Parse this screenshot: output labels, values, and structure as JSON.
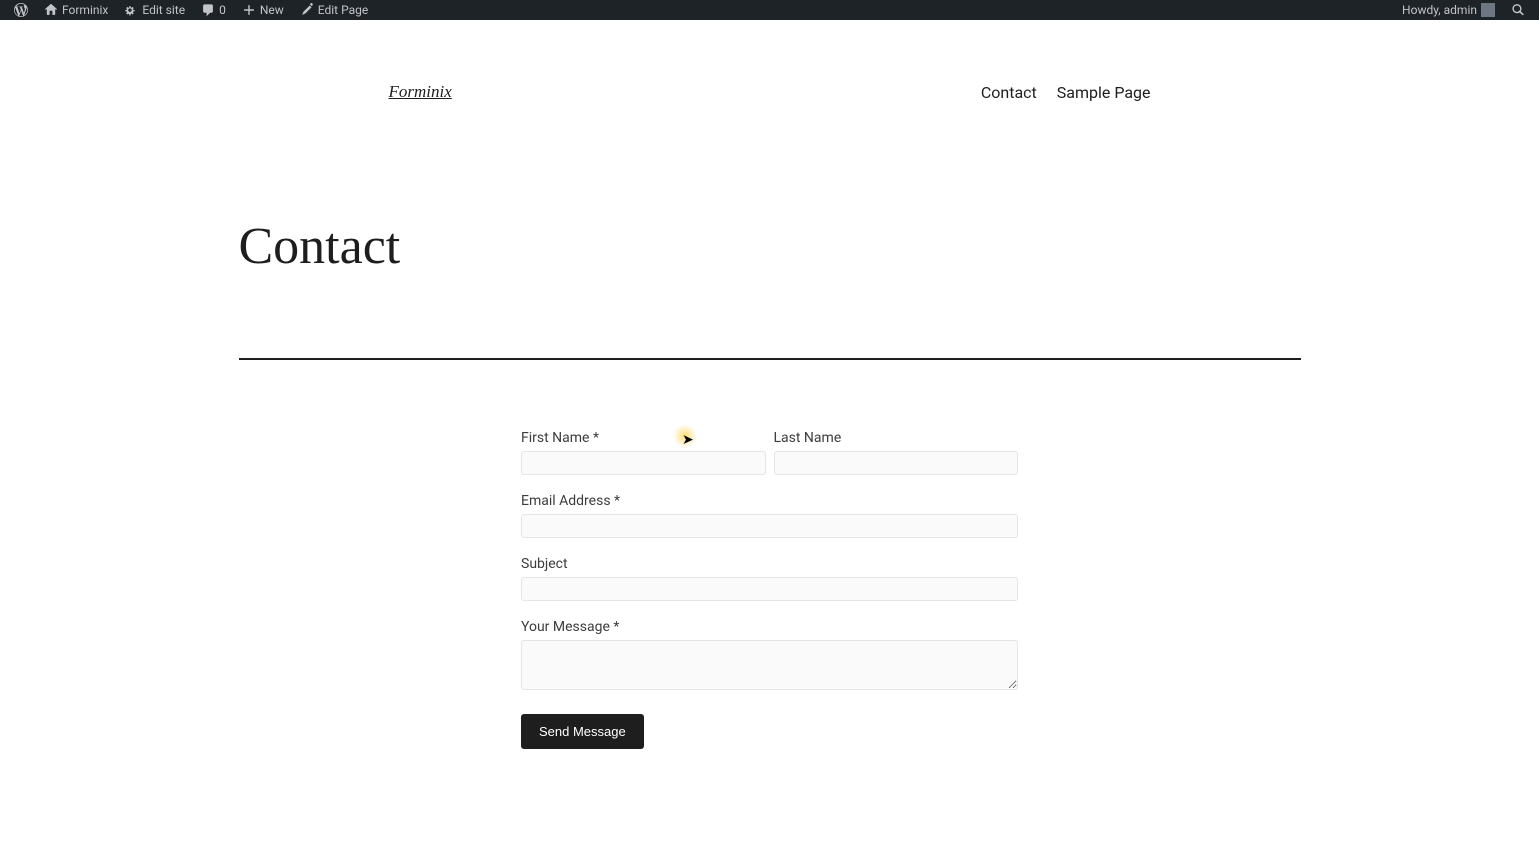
{
  "adminBar": {
    "siteName": "Forminix",
    "editSite": "Edit site",
    "commentCount": "0",
    "new": "New",
    "editPage": "Edit Page",
    "greeting": "Howdy, admin"
  },
  "header": {
    "siteTitle": "Forminix",
    "nav": {
      "contact": "Contact",
      "samplePage": "Sample Page"
    }
  },
  "page": {
    "title": "Contact"
  },
  "form": {
    "firstName": {
      "label": "First Name *",
      "value": ""
    },
    "lastName": {
      "label": "Last Name",
      "value": ""
    },
    "email": {
      "label": "Email Address *",
      "value": ""
    },
    "subject": {
      "label": "Subject",
      "value": ""
    },
    "message": {
      "label": "Your Message *",
      "value": ""
    },
    "submit": "Send Message"
  }
}
